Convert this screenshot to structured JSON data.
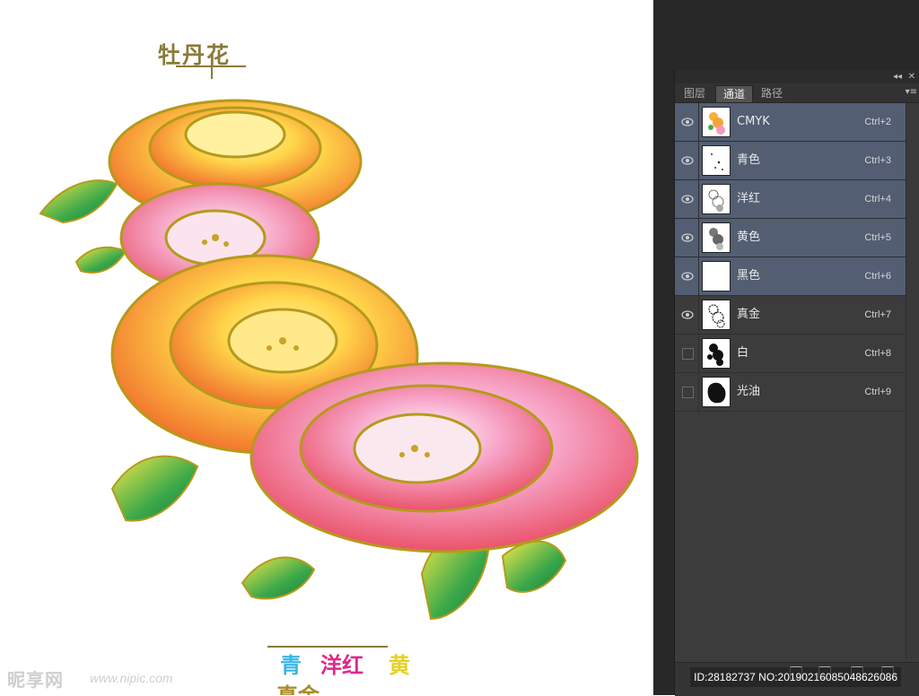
{
  "canvas": {
    "title": "牡丹花",
    "captions": [
      {
        "text": "青",
        "color": "#38b6e6"
      },
      {
        "text": "洋红",
        "color": "#e0288a"
      },
      {
        "text": "黄",
        "color": "#e7d21a"
      },
      {
        "text": "真金",
        "color": "#a78c2a"
      }
    ],
    "watermark_logo": "昵享网",
    "watermark_url": "www.nipic.com"
  },
  "panel": {
    "collapse_icon": "double-left-arrow-icon",
    "close_icon": "close-icon",
    "tabs": [
      {
        "label": "图层",
        "active": false
      },
      {
        "label": "通道",
        "active": true
      },
      {
        "label": "路径",
        "active": false
      }
    ],
    "menu_icon": "panel-menu-icon",
    "channels": [
      {
        "name": "CMYK",
        "shortcut": "Ctrl+2",
        "visible": true,
        "selected": true
      },
      {
        "name": "青色",
        "shortcut": "Ctrl+3",
        "visible": true,
        "selected": true
      },
      {
        "name": "洋红",
        "shortcut": "Ctrl+4",
        "visible": true,
        "selected": true
      },
      {
        "name": "黄色",
        "shortcut": "Ctrl+5",
        "visible": true,
        "selected": true
      },
      {
        "name": "黑色",
        "shortcut": "Ctrl+6",
        "visible": true,
        "selected": true
      },
      {
        "name": "真金",
        "shortcut": "Ctrl+7",
        "visible": true,
        "selected": false
      },
      {
        "name": "白",
        "shortcut": "Ctrl+8",
        "visible": false,
        "selected": false
      },
      {
        "name": "光油",
        "shortcut": "Ctrl+9",
        "visible": false,
        "selected": false
      }
    ],
    "selected_color": "#535e73",
    "watermark_id": "ID:28182737 NO:20190216085048626086"
  }
}
